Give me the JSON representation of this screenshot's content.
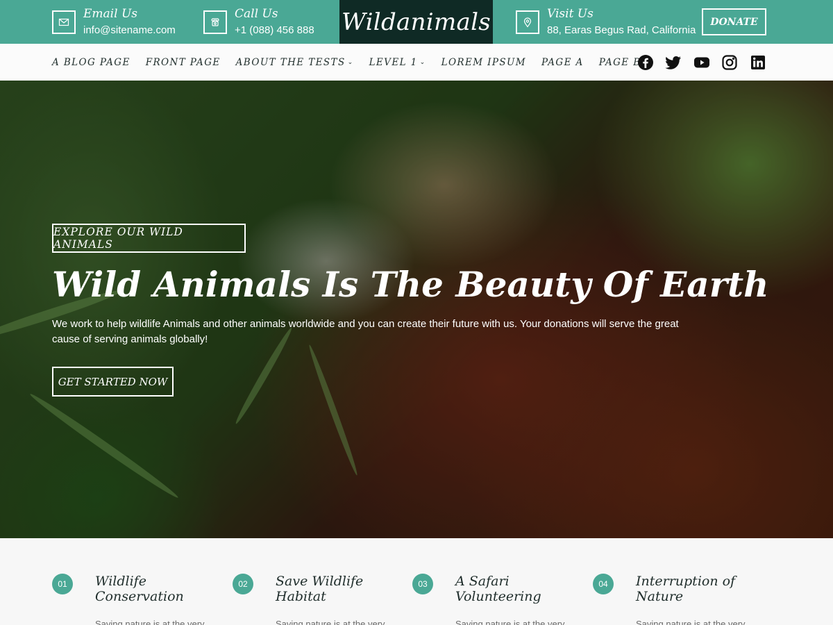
{
  "topbar": {
    "email": {
      "title": "Email Us",
      "value": "info@sitename.com",
      "icon": "envelope-icon"
    },
    "call": {
      "title": "Call Us",
      "value": "+1 (088) 456 888",
      "icon": "phone-icon"
    },
    "logo": "Wildanimals",
    "visit": {
      "title": "Visit Us",
      "value": "88, Earas Begus Rad, California",
      "icon": "location-pin-icon"
    },
    "donate_label": "DONATE"
  },
  "nav": {
    "items": [
      {
        "label": "A BLOG PAGE"
      },
      {
        "label": "FRONT PAGE"
      },
      {
        "label": "ABOUT THE TESTS",
        "dropdown": true
      },
      {
        "label": "LEVEL 1",
        "dropdown": true
      },
      {
        "label": "LOREM IPSUM"
      },
      {
        "label": "PAGE A"
      },
      {
        "label": "PAGE B"
      }
    ],
    "social": [
      "facebook-icon",
      "twitter-icon",
      "youtube-icon",
      "instagram-icon",
      "linkedin-icon"
    ]
  },
  "hero": {
    "explore_label": "EXPLORE OUR WILD ANIMALS",
    "title": "Wild Animals Is The Beauty Of Earth",
    "text": "We work to help wildlife Animals and other animals worldwide and you can create their future with us. Your donations will serve the great cause of serving animals globally!",
    "cta_label": "GET STARTED NOW"
  },
  "features": [
    {
      "num": "01",
      "title": "Wildlife Conservation",
      "desc": "Saving nature is at the very"
    },
    {
      "num": "02",
      "title": "Save Wildlife Habitat",
      "desc": "Saving nature is at the very"
    },
    {
      "num": "03",
      "title": "A Safari Volunteering",
      "desc": "Saving nature is at the very"
    },
    {
      "num": "04",
      "title": "Interruption of Nature",
      "desc": "Saving nature is at the very"
    }
  ],
  "colors": {
    "accent": "#4aa895",
    "logo_bg": "#0f2a25",
    "text_dark": "#1f2d2b"
  }
}
